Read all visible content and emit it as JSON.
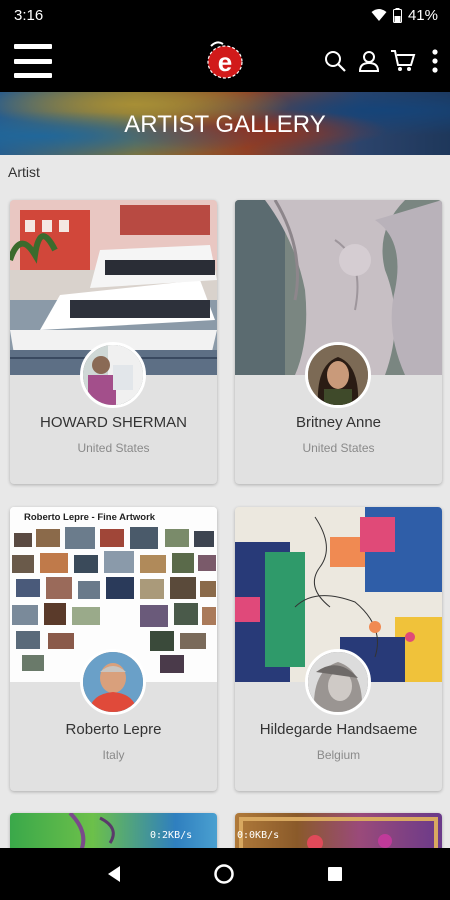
{
  "status": {
    "time": "3:16",
    "battery": "41%"
  },
  "app_bar": {
    "logo_letter": "e"
  },
  "hero": {
    "title": "ARTIST GALLERY"
  },
  "section": {
    "label": "Artist"
  },
  "artists": [
    {
      "name": "HOWARD SHERMAN",
      "country": "United States"
    },
    {
      "name": "Britney Anne",
      "country": "United States"
    },
    {
      "name": "Roberto Lepre",
      "country": "Italy",
      "art_caption": "Roberto Lepre -  Fine Artwork"
    },
    {
      "name": "Hildegarde Handsaeme",
      "country": "Belgium"
    }
  ],
  "partial_cards": [
    {
      "speed": "0:2KB/s"
    },
    {
      "speed": "0:0KB/s"
    }
  ]
}
